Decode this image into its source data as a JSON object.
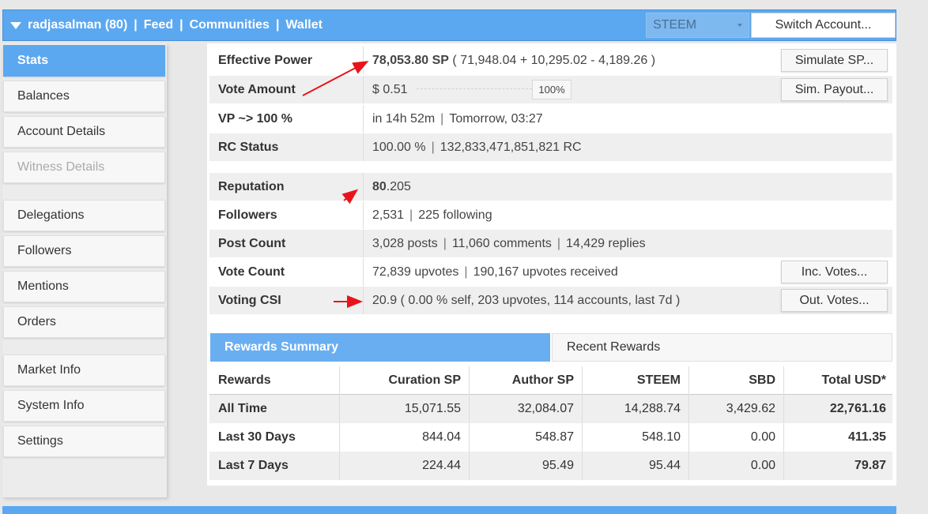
{
  "topbar": {
    "account": "radjasalman (80)",
    "nav": [
      "Feed",
      "Communities",
      "Wallet"
    ],
    "separator": "|",
    "chain_select": "STEEM",
    "switch_account": "Switch Account..."
  },
  "sidebar": {
    "items": [
      {
        "label": "Stats"
      },
      {
        "label": "Balances"
      },
      {
        "label": "Account Details"
      },
      {
        "label": "Witness Details"
      },
      {
        "label": "Delegations"
      },
      {
        "label": "Followers"
      },
      {
        "label": "Mentions"
      },
      {
        "label": "Orders"
      },
      {
        "label": "Market Info"
      },
      {
        "label": "System Info"
      },
      {
        "label": "Settings"
      }
    ]
  },
  "stats": {
    "effective_power": {
      "label": "Effective Power",
      "value": "78,053.80 SP",
      "detail": "( 71,948.04 + 10,295.02 - 4,189.26 )",
      "button": "Simulate SP..."
    },
    "vote_amount": {
      "label": "Vote Amount",
      "value": "$ 0.51",
      "slider_pct": "100%",
      "button": "Sim. Payout..."
    },
    "vp": {
      "label": "VP ~> 100 %",
      "value": "in 14h 52m",
      "detail": "Tomorrow, 03:27"
    },
    "rc": {
      "label": "RC Status",
      "value": "100.00 %",
      "detail": "132,833,471,851,821 RC"
    },
    "reputation": {
      "label": "Reputation",
      "whole": "80",
      "fraction": ".205"
    },
    "followers": {
      "label": "Followers",
      "value": "2,531",
      "detail": "225 following"
    },
    "post_count": {
      "label": "Post Count",
      "value": "3,028 posts",
      "comments": "11,060 comments",
      "replies": "14,429 replies"
    },
    "vote_count": {
      "label": "Vote Count",
      "value": "72,839 upvotes",
      "detail": "190,167 upvotes received",
      "button": "Inc. Votes..."
    },
    "voting_csi": {
      "label": "Voting CSI",
      "value": "20.9 ( 0.00 % self, 203 upvotes, 114 accounts, last 7d )",
      "button": "Out. Votes..."
    }
  },
  "rewards": {
    "tab_summary": "Rewards Summary",
    "tab_recent": "Recent Rewards",
    "columns": [
      "Rewards",
      "Curation SP",
      "Author SP",
      "STEEM",
      "SBD",
      "Total USD*"
    ],
    "rows": [
      [
        "All Time",
        "15,071.55",
        "32,084.07",
        "14,288.74",
        "3,429.62",
        "22,761.16"
      ],
      [
        "Last 30 Days",
        "844.04",
        "548.87",
        "548.10",
        "0.00",
        "411.35"
      ],
      [
        "Last 7 Days",
        "224.44",
        "95.49",
        "95.44",
        "0.00",
        "79.87"
      ]
    ]
  },
  "colors": {
    "accent": "#5ba8f0",
    "annotation": "#e8141b"
  }
}
